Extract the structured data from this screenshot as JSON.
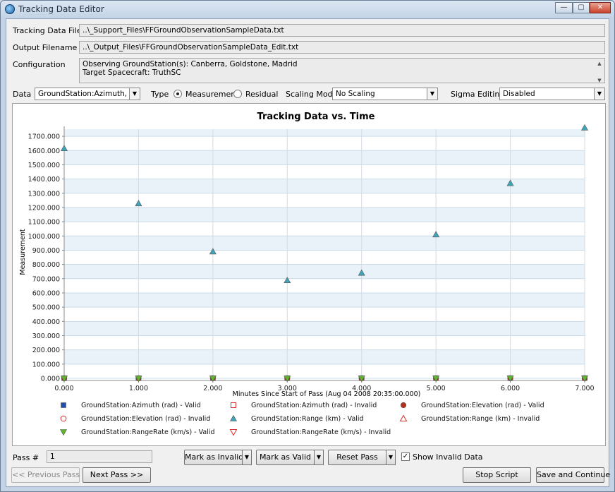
{
  "window": {
    "title": "Tracking Data Editor",
    "minimize_glyph": "—",
    "maximize_glyph": "▢",
    "close_glyph": "✕"
  },
  "form": {
    "tracking_data_file_label": "Tracking Data File",
    "tracking_data_file_value": "..\\_Support_Files\\FFGroundObservationSampleData.txt",
    "output_filename_label": "Output Filename",
    "output_filename_value": "..\\_Output_Files\\FFGroundObservationSampleData_Edit.txt",
    "configuration_label": "Configuration",
    "configuration_line1": "Observing GroundStation(s): Canberra, Goldstone, Madrid",
    "configuration_line2": "Target Spacecraft: TruthSC"
  },
  "controls": {
    "data_label": "Data",
    "data_value": "GroundStation:Azimuth, Gr...",
    "type_label": "Type",
    "type_measurement": "Measurement",
    "type_residual": "Residual",
    "type_selected": "Measurement",
    "scaling_label": "Scaling Mode",
    "scaling_value": "No Scaling",
    "sigma_label": "Sigma Editing",
    "sigma_value": "Disabled"
  },
  "chart_data": {
    "type": "scatter",
    "title": "Tracking Data vs. Time",
    "xlabel": "Minutes Since Start of Pass (Aug 04 2008 20:35:00.000)",
    "ylabel": "Measurement",
    "xlim": [
      0,
      7
    ],
    "ylim": [
      0,
      1750
    ],
    "x_ticks": [
      "0.000",
      "1.000",
      "2.000",
      "3.000",
      "4.000",
      "5.000",
      "6.000",
      "7.000"
    ],
    "y_ticks": [
      "0.000",
      "100.000",
      "200.000",
      "300.000",
      "400.000",
      "500.000",
      "600.000",
      "700.000",
      "800.000",
      "900.000",
      "1000.000",
      "1100.000",
      "1200.000",
      "1300.000",
      "1400.000",
      "1500.000",
      "1600.000",
      "1700.000"
    ],
    "grid": true,
    "series": [
      {
        "name": "GroundStation:Azimuth (rad) - Valid",
        "marker": "square",
        "color": "#1f4fa8",
        "filled": true,
        "x": [
          0,
          1,
          2,
          3,
          4,
          5,
          6,
          7
        ],
        "y": [
          1.2,
          1.3,
          1.4,
          1.5,
          1.6,
          1.7,
          1.8,
          1.9
        ]
      },
      {
        "name": "GroundStation:Azimuth (rad) - Invalid",
        "marker": "square",
        "color": "#d62d2d",
        "filled": false,
        "x": [],
        "y": []
      },
      {
        "name": "GroundStation:Elevation (rad) - Valid",
        "marker": "circle",
        "color": "#b5321a",
        "filled": true,
        "x": [
          0,
          1,
          2,
          3,
          4,
          5,
          6,
          7
        ],
        "y": [
          0.5,
          0.6,
          0.6,
          0.7,
          0.7,
          0.8,
          0.8,
          0.9
        ]
      },
      {
        "name": "GroundStation:Elevation (rad) - Invalid",
        "marker": "circle",
        "color": "#d62d2d",
        "filled": false,
        "x": [],
        "y": []
      },
      {
        "name": "GroundStation:Range (km) - Valid",
        "marker": "triangle",
        "color": "#41a3b8",
        "filled": true,
        "x": [
          0,
          1,
          2,
          3,
          4,
          5,
          6,
          7
        ],
        "y": [
          1615,
          1228,
          890,
          688,
          740,
          1010,
          1370,
          1760
        ]
      },
      {
        "name": "GroundStation:Range (km) - Invalid",
        "marker": "triangle",
        "color": "#d62d2d",
        "filled": false,
        "x": [],
        "y": []
      },
      {
        "name": "GroundStation:RangeRate (km/s) - Valid",
        "marker": "triangle-down",
        "color": "#5cb82a",
        "filled": true,
        "x": [
          0,
          1,
          2,
          3,
          4,
          5,
          6,
          7
        ],
        "y": [
          -0.3,
          -0.2,
          -0.1,
          0,
          0.1,
          0.2,
          0.3,
          0.4
        ]
      },
      {
        "name": "GroundStation:RangeRate (km/s) - Invalid",
        "marker": "triangle-down",
        "color": "#d62d2d",
        "filled": false,
        "x": [],
        "y": []
      }
    ]
  },
  "bottom": {
    "pass_label": "Pass #",
    "pass_value": "1",
    "mark_invalid": "Mark as Invalid",
    "mark_valid": "Mark as Valid",
    "reset_pass": "Reset Pass",
    "show_invalid_label": "Show Invalid Data",
    "show_invalid_checked": true,
    "check_glyph": "✓",
    "previous_pass": "<< Previous Pass",
    "next_pass": "Next Pass >>",
    "stop_script": "Stop Script",
    "save_continue": "Save and Continue",
    "dropdown_glyph": "▼"
  }
}
